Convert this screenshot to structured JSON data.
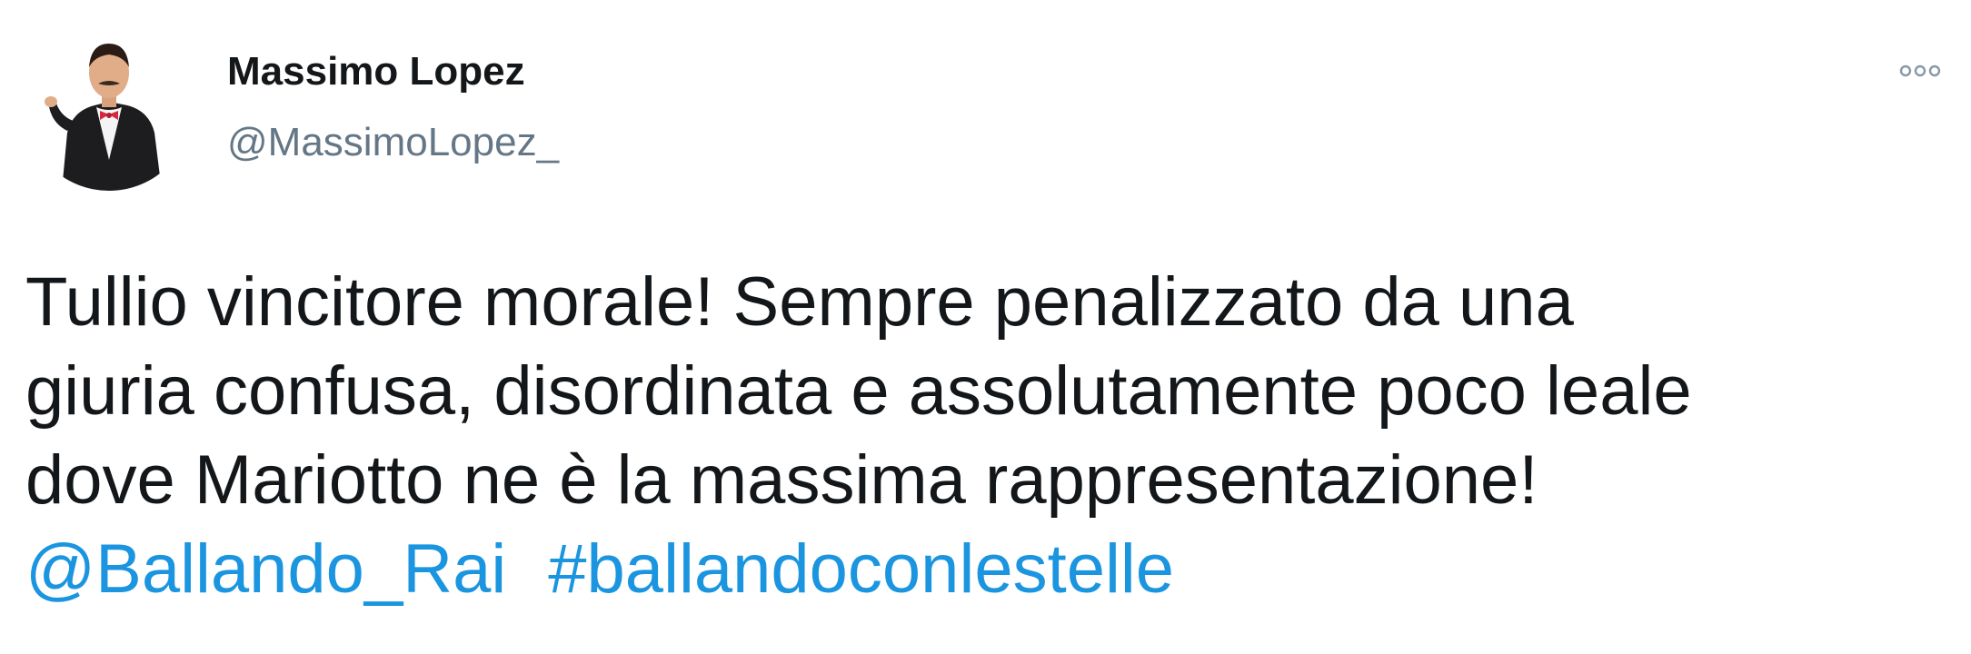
{
  "author": {
    "name": "Massimo Lopez",
    "handle": "@MassimoLopez_"
  },
  "menu": {
    "icon": "more-dots-icon"
  },
  "tweet": {
    "lines": [
      "Tullio vincitore morale! Sempre penalizzato da una",
      "giuria confusa, disordinata e assolutamente poco leale",
      "dove Mariotto ne è la massima rappresentazione!"
    ],
    "mention": "@Ballando_Rai",
    "hashtag": "#ballandoconlestelle"
  },
  "colors": {
    "text": "#14171a",
    "secondary": "#657786",
    "link": "#1b95e0"
  }
}
